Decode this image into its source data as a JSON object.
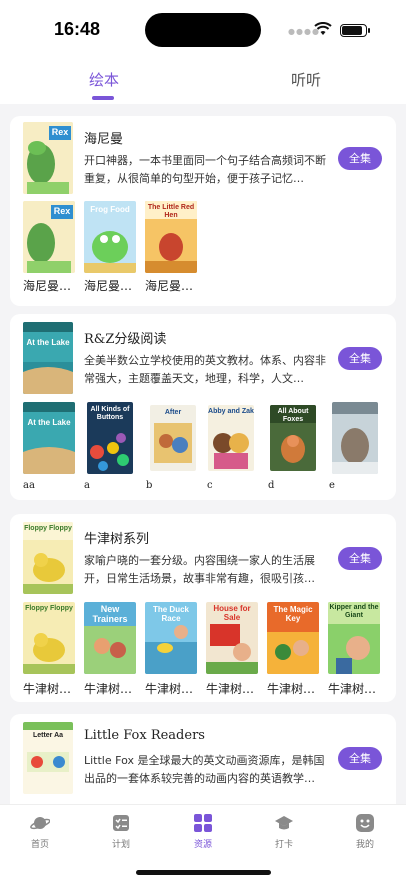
{
  "status": {
    "time": "16:48"
  },
  "tabs": [
    {
      "label": "绘本"
    },
    {
      "label": "听听"
    }
  ],
  "cards": [
    {
      "title": "海尼曼",
      "desc": "开口神器，一本书里面同一个句子结合高频词不断重复，从很简单的句型开始，便于孩子记忆…",
      "button": "全集",
      "cover_text": "Rex",
      "thumbs": [
        {
          "label": "海尼曼…",
          "title": "Rex"
        },
        {
          "label": "海尼曼…",
          "title": "Frog Food"
        },
        {
          "label": "海尼曼…",
          "title": "The Little Red Hen"
        }
      ]
    },
    {
      "title": "R&Z分级阅读",
      "desc": "全美半数公立学校使用的英文教材。体系、内容非常强大，主题覆盖天文，地理，科学，人文…",
      "button": "全集",
      "cover_text": "At the Lake",
      "thumbs": [
        {
          "label": "aa",
          "title": "At the Lake"
        },
        {
          "label": "a",
          "title": "All Kinds of Buttons"
        },
        {
          "label": "b",
          "title": "After"
        },
        {
          "label": "c",
          "title": "Abby and Zak"
        },
        {
          "label": "d",
          "title": "All About Foxes"
        },
        {
          "label": "e",
          "title": ""
        }
      ]
    },
    {
      "title": "牛津树系列",
      "desc": "家喻户晓的一套分级。内容围绕一家人的生活展开，日常生活场景，故事非常有趣，很吸引孩…",
      "button": "全集",
      "cover_text": "Floppy Floppy",
      "thumbs": [
        {
          "label": "牛津树…",
          "title": "Floppy Floppy"
        },
        {
          "label": "牛津树…",
          "title": "New Trainers"
        },
        {
          "label": "牛津树…",
          "title": "The Duck Race"
        },
        {
          "label": "牛津树…",
          "title": "House for Sale"
        },
        {
          "label": "牛津树…",
          "title": "The Magic Key"
        },
        {
          "label": "牛津树…",
          "title": "Kipper and the Giant"
        }
      ]
    },
    {
      "title": "Little Fox Readers",
      "desc": "Little Fox 是全球最大的英文动画资源库，是韩国出品的一套体系较完善的动画内容的英语教学…",
      "button": "全集",
      "cover_text": "Letter Aa",
      "thumbs": []
    }
  ],
  "nav": [
    {
      "label": "首页",
      "icon": "planet-icon"
    },
    {
      "label": "计划",
      "icon": "checklist-icon"
    },
    {
      "label": "资源",
      "icon": "grid-icon"
    },
    {
      "label": "打卡",
      "icon": "graduation-cap-icon"
    },
    {
      "label": "我的",
      "icon": "smiley-face-icon"
    }
  ],
  "colors": {
    "accent": "#7a55d8"
  }
}
